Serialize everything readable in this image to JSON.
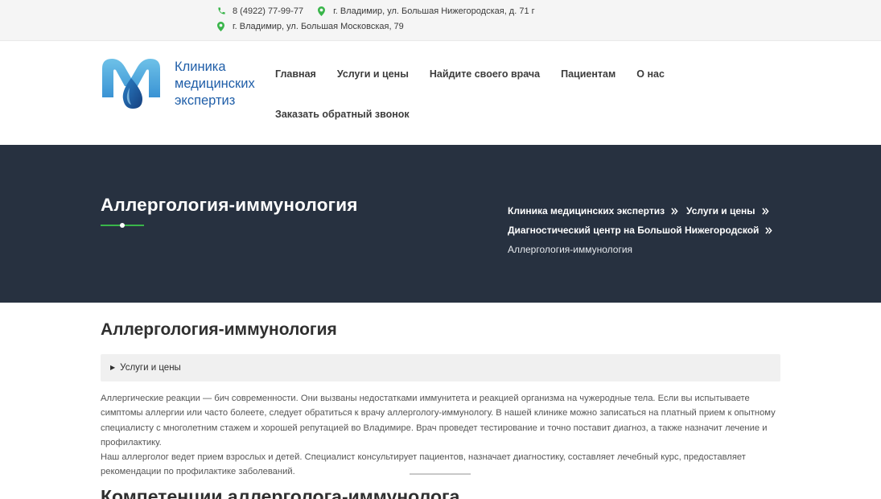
{
  "topbar": {
    "phone": "8 (4922) 77-99-77",
    "address1": "г. Владимир, ул. Большая Нижегородская, д. 71 г",
    "address2": "г. Владимир, ул. Большая Московская, 79",
    "accent_color": "#39b54a"
  },
  "logo": {
    "line1": "Клиника",
    "line2": "медицинских",
    "line3": "экспертиз",
    "brand_color": "#1f5ea8"
  },
  "nav": {
    "items": [
      "Главная",
      "Услуги и цены",
      "Найдите своего врача",
      "Пациентам",
      "О нас"
    ],
    "callback": "Заказать обратный звонок"
  },
  "hero": {
    "title": "Аллергология-иммунология",
    "background_color": "#273140",
    "breadcrumb": {
      "item1": "Клиника медицинских экспертиз",
      "item2": "Услуги и цены",
      "item3": "Диагностический центр на Большой Нижегородской",
      "current": "Аллергология-иммунология"
    }
  },
  "content": {
    "title": "Аллергология-иммунология",
    "details_summary": "Услуги и цены",
    "paragraph1": "Аллергические реакции — бич современности. Они вызваны недостатками иммунитета и реакцией организма на чужеродные тела. Если вы испытываете симптомы аллергии или часто болеете, следует обратиться к врачу аллергологу-иммунологу. В нашей клинике можно записаться на платный прием к опытному специалисту с многолетним стажем и хорошей репутацией во Владимире. Врач проведет тестирование и точно поставит диагноз, а также назначит лечение и профилактику.",
    "paragraph2": "Наш аллерголог ведет прием взрослых и детей. Специалист консультирует пациентов, назначает диагностику, составляет лечебный курс, предоставляет рекомендации по профилактике заболеваний.",
    "next_heading": "Компетенции аллерголога-иммунолога"
  }
}
